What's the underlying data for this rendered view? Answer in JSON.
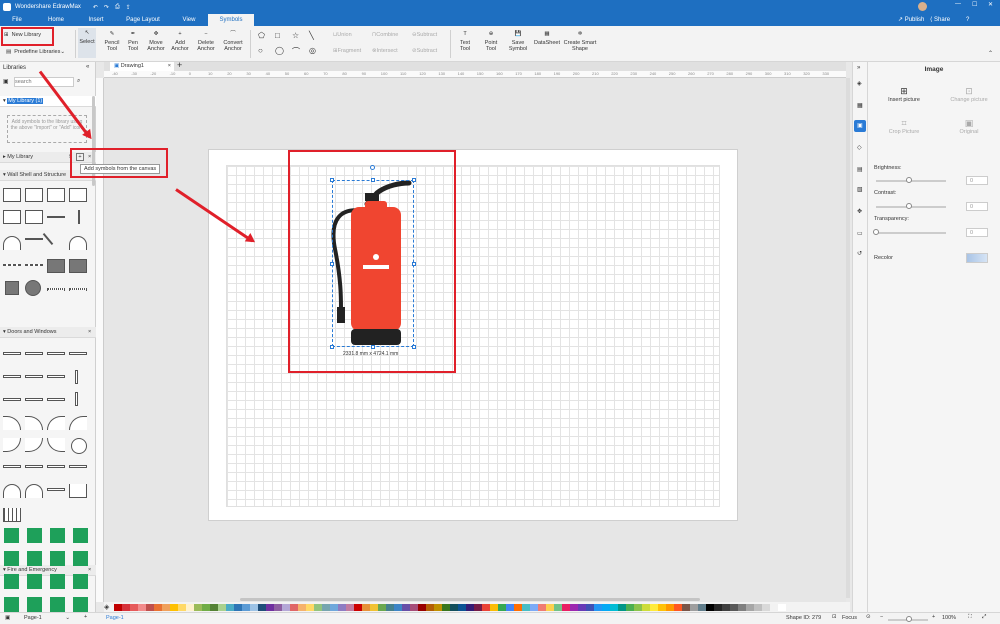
{
  "app": {
    "title": "Wondershare EdrawMax",
    "publish": "Publish",
    "share": "Share",
    "help": "?"
  },
  "menu": [
    "File",
    "Home",
    "Insert",
    "Page Layout",
    "View",
    "Symbols"
  ],
  "toolbar": {
    "new_library": "New Library",
    "predefine": "Predefine Libraries",
    "select": "Select",
    "pencil": "Pencil Tool",
    "pen": "Pen Tool",
    "move_anchor": "Move Anchor",
    "add_anchor": "Add Anchor",
    "delete_anchor": "Delete Anchor",
    "convert_anchor": "Convert Anchor",
    "union": "Union",
    "combine": "Combine",
    "subtract": "Subtract",
    "fragment": "Fragment",
    "intersect": "Intersect",
    "subtract2": "Subtract",
    "text_tool": "Text Tool",
    "point_tool": "Point Tool",
    "save_symbol": "Save Symbol",
    "datasheet": "DataSheet",
    "create_smart": "Create Smart Shape"
  },
  "left": {
    "header": "Libraries",
    "search_placeholder": "search",
    "my_library_selected": "My Library (1)",
    "empty_hint": "Add symbols to the library using the above \"Import\" or \"Add\" icon.",
    "my_library": "My Library",
    "tooltip": "Add symbols from the canvas",
    "wall": "Wall Shell and Structure",
    "doors": "Doors and Windows",
    "fire": "Fire and Emergency"
  },
  "tab": {
    "name": "Drawing1"
  },
  "ruler": [
    "-40",
    "-30",
    "-20",
    "-10",
    "0",
    "10",
    "20",
    "30",
    "40",
    "50",
    "60",
    "70",
    "80",
    "90",
    "100",
    "110",
    "120",
    "130",
    "140",
    "150",
    "160",
    "170",
    "180",
    "190",
    "200",
    "210",
    "220",
    "230",
    "240",
    "250",
    "260",
    "270",
    "280",
    "290",
    "300",
    "310",
    "320",
    "330"
  ],
  "shape": {
    "size_label": "2331.8 mm x 4724.1 mm"
  },
  "right": {
    "title": "Image",
    "insert": "Insert picture",
    "change": "Change picture",
    "crop": "Crop Picture",
    "original": "Original",
    "brightness": "Brightness:",
    "contrast": "Contrast:",
    "transparency": "Transparency:",
    "recolor": "Recolor",
    "zero": "0"
  },
  "status": {
    "page_select": "Page-1",
    "page_tab": "Page-1",
    "shape_id": "Shape ID: 279",
    "focus": "Focus",
    "zoom": "100%"
  },
  "colors": {
    "accent": "#1e6fc1",
    "extinguisher": "#f04530",
    "highlight": "#e0202a",
    "fire_green": "#1ea05a"
  },
  "palette": [
    "#c00000",
    "#d6323a",
    "#e65a5a",
    "#f28b8b",
    "#c0504d",
    "#e97132",
    "#f0a05a",
    "#ffc000",
    "#ffd966",
    "#fff2cc",
    "#9bbb59",
    "#70ad47",
    "#548235",
    "#a9d18e",
    "#4bacc6",
    "#2e75b6",
    "#5b9bd5",
    "#9dc3e6",
    "#1f4e79",
    "#7030a0",
    "#8e5ea2",
    "#b4a7d6",
    "#e06666",
    "#f6b26b",
    "#ffd966",
    "#93c47d",
    "#76a5af",
    "#6fa8dc",
    "#8e7cc3",
    "#c27ba0",
    "#cc0000",
    "#e69138",
    "#f1c232",
    "#6aa84f",
    "#45818e",
    "#3d85c6",
    "#674ea7",
    "#a64d79",
    "#990000",
    "#b45f06",
    "#bf9000",
    "#38761d",
    "#134f5c",
    "#0b5394",
    "#351c75",
    "#741b47",
    "#ea4335",
    "#fbbc04",
    "#34a853",
    "#4285f4",
    "#ff6d01",
    "#46bdc6",
    "#7baaf7",
    "#f07b72",
    "#fcd04f",
    "#71c287",
    "#e91e63",
    "#9c27b0",
    "#673ab7",
    "#3f51b5",
    "#2196f3",
    "#03a9f4",
    "#00bcd4",
    "#009688",
    "#4caf50",
    "#8bc34a",
    "#cddc39",
    "#ffeb3b",
    "#ffc107",
    "#ff9800",
    "#ff5722",
    "#795548",
    "#9e9e9e",
    "#607d8b",
    "#000000",
    "#262626",
    "#404040",
    "#595959",
    "#7f7f7f",
    "#a6a6a6",
    "#bfbfbf",
    "#d9d9d9",
    "#f2f2f2",
    "#ffffff"
  ]
}
